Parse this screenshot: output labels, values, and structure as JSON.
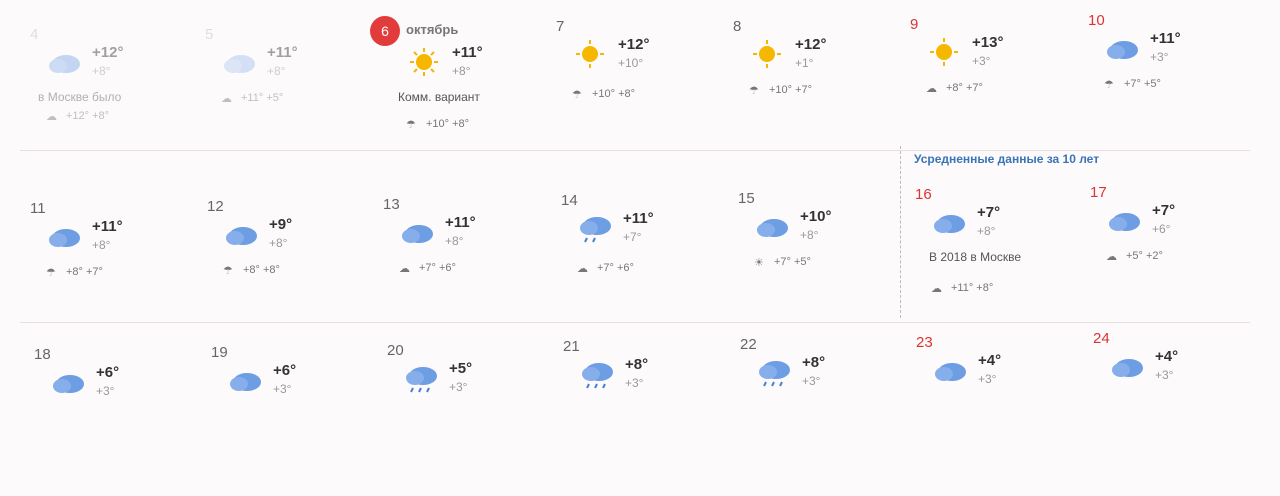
{
  "today": {
    "badge": "6",
    "label": "октябрь"
  },
  "avg_section_title": "Усредненные данные за 10 лет",
  "row1": [
    {
      "day": "4",
      "hi": "+12°",
      "lo": "+8°",
      "note": "в Москве было",
      "hist": "+12° +8°",
      "icon": "cloud",
      "faded": true
    },
    {
      "day": "5",
      "hi": "+11°",
      "lo": "+8°",
      "note": "",
      "hist": "+11° +5°",
      "icon": "cloud",
      "faded": true
    },
    {
      "day": "",
      "hi": "+11°",
      "lo": "+8°",
      "note": "Комм. вариант",
      "hist": "+10° +8°",
      "icon": "sun",
      "today": true
    },
    {
      "day": "7",
      "hi": "+12°",
      "lo": "+10°",
      "note": "",
      "hist": "+10° +8°",
      "icon": "sun"
    },
    {
      "day": "8",
      "hi": "+12°",
      "lo": "+1°",
      "note": "",
      "hist": "+10° +7°",
      "icon": "sun"
    },
    {
      "day": "9",
      "hi": "+13°",
      "lo": "+3°",
      "note": "",
      "hist": "+8° +7°",
      "icon": "sun",
      "red": true
    },
    {
      "day": "10",
      "hi": "+11°",
      "lo": "+3°",
      "note": "",
      "hist": "+7° +5°",
      "icon": "cloud",
      "red": true
    }
  ],
  "row2": [
    {
      "day": "11",
      "hi": "+11°",
      "lo": "+8°",
      "hist": "+8° +7°",
      "icon": "cloud"
    },
    {
      "day": "12",
      "hi": "+9°",
      "lo": "+8°",
      "hist": "+8° +8°",
      "icon": "cloud"
    },
    {
      "day": "13",
      "hi": "+11°",
      "lo": "+8°",
      "hist": "+7° +6°",
      "icon": "cloud"
    },
    {
      "day": "14",
      "hi": "+11°",
      "lo": "+7°",
      "hist": "+7° +6°",
      "icon": "rain"
    },
    {
      "day": "15",
      "hi": "+10°",
      "lo": "+8°",
      "hist": "+7° +5°",
      "icon": "cloud"
    },
    {
      "day": "16",
      "hi": "+7°",
      "lo": "+8°",
      "note": "В 2018 в Москве",
      "hist": "+11° +8°",
      "icon": "cloud",
      "red": true
    },
    {
      "day": "17",
      "hi": "+7°",
      "lo": "+6°",
      "hist": "+5° +2°",
      "icon": "cloud",
      "red": true
    }
  ],
  "row3": [
    {
      "day": "18",
      "hi": "+6°",
      "lo": "+3°",
      "icon": "cloud"
    },
    {
      "day": "19",
      "hi": "+6°",
      "lo": "+3°",
      "icon": "cloud"
    },
    {
      "day": "20",
      "hi": "+5°",
      "lo": "+3°",
      "icon": "rain"
    },
    {
      "day": "21",
      "hi": "+8°",
      "lo": "+3°",
      "icon": "rain"
    },
    {
      "day": "22",
      "hi": "+8°",
      "lo": "+3°",
      "icon": "rain"
    },
    {
      "day": "23",
      "hi": "+4°",
      "lo": "+3°",
      "icon": "cloud",
      "red": true
    },
    {
      "day": "24",
      "hi": "+4°",
      "lo": "+3°",
      "icon": "cloud",
      "red": true
    }
  ]
}
